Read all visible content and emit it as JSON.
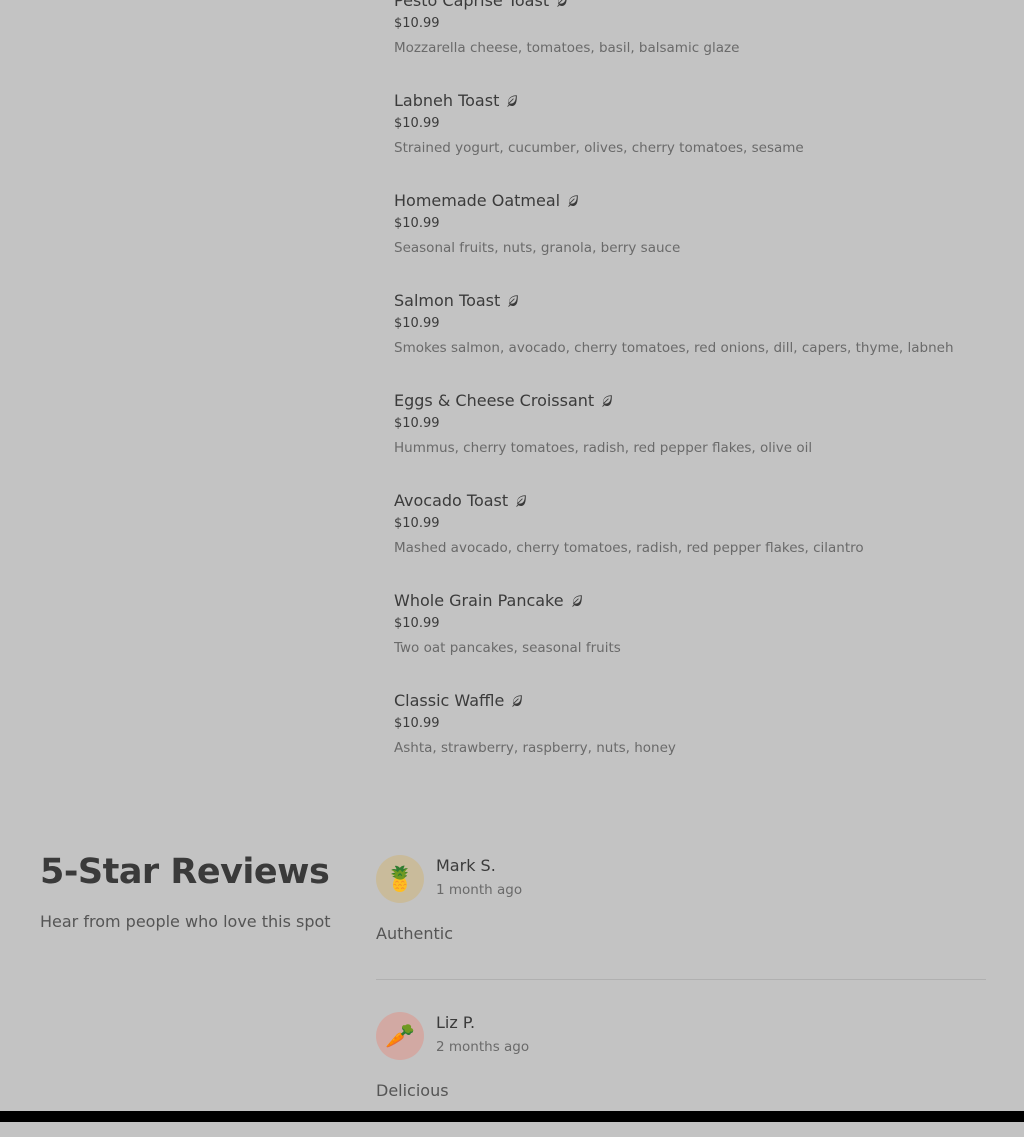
{
  "menu": {
    "items": [
      {
        "name": "Pesto Caprise Toast",
        "price": "$10.99",
        "description": "Mozzarella cheese, tomatoes, basil, balsamic glaze",
        "icon": "leaf-icon"
      },
      {
        "name": "Labneh Toast",
        "price": "$10.99",
        "description": "Strained yogurt, cucumber, olives, cherry tomatoes, sesame",
        "icon": "leaf-icon"
      },
      {
        "name": "Homemade Oatmeal",
        "price": "$10.99",
        "description": "Seasonal fruits, nuts, granola, berry sauce",
        "icon": "leaf-icon"
      },
      {
        "name": "Salmon Toast",
        "price": "$10.99",
        "description": "Smokes salmon, avocado, cherry tomatoes, red onions, dill, capers, thyme, labneh",
        "icon": "leaf-icon"
      },
      {
        "name": "Eggs & Cheese Croissant",
        "price": "$10.99",
        "description": "Hummus, cherry tomatoes, radish, red pepper flakes, olive oil",
        "icon": "leaf-icon"
      },
      {
        "name": "Avocado Toast",
        "price": "$10.99",
        "description": "Mashed avocado, cherry tomatoes, radish, red pepper flakes, cilantro",
        "icon": "leaf-icon"
      },
      {
        "name": "Whole Grain Pancake",
        "price": "$10.99",
        "description": "Two oat pancakes, seasonal fruits",
        "icon": "leaf-icon"
      },
      {
        "name": "Classic Waffle",
        "price": "$10.99",
        "description": "Ashta, strawberry, raspberry, nuts, honey",
        "icon": "leaf-icon"
      }
    ]
  },
  "reviews": {
    "heading": "5-Star Reviews",
    "subtitle": "Hear from people who love this spot",
    "items": [
      {
        "name": "Mark S.",
        "date": "1 month ago",
        "text": "Authentic",
        "avatar": "🍍",
        "avatar_icon": "pineapple-icon",
        "avatar_color": "#c9bb9b"
      },
      {
        "name": "Liz P.",
        "date": "2 months ago",
        "text": "Delicious",
        "avatar": "🥕",
        "avatar_icon": "carrot-icon",
        "avatar_color": "#d2a9a3"
      }
    ]
  },
  "colors": {
    "background": "#c3c3c3",
    "text_primary": "#3b3b3b",
    "text_secondary": "#6a6a6a",
    "bottom_bar": "#000000"
  }
}
